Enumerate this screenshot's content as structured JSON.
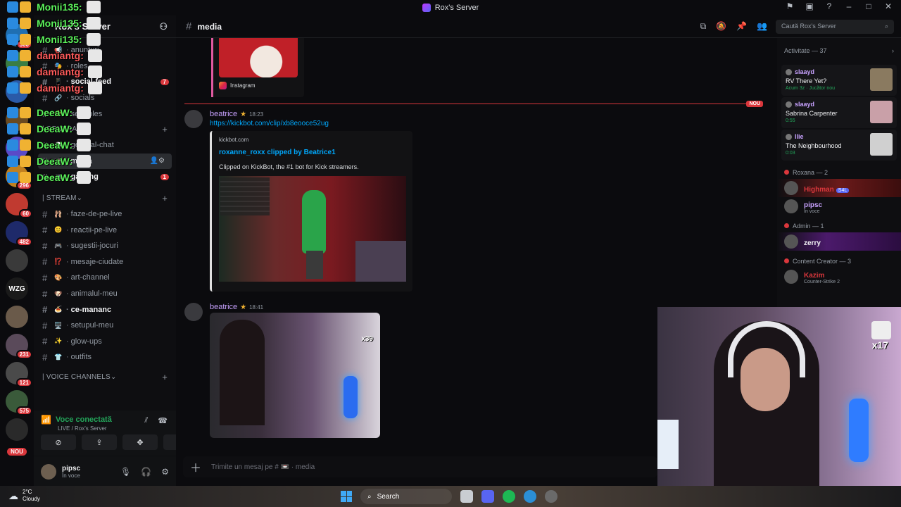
{
  "window": {
    "title": "Rox's Server"
  },
  "server": {
    "name": "Rox's Server"
  },
  "rail": {
    "servers": [
      {
        "label": "",
        "badge": "300",
        "color": "#1f6fb2"
      },
      {
        "label": "",
        "badge": "",
        "color": "#3a7d44"
      },
      {
        "label": "",
        "badge": "",
        "color": "#2a5aa8"
      },
      {
        "label": "",
        "badge": "",
        "color": "#6a4a20"
      },
      {
        "label": "",
        "badge": "",
        "color": "#5a4ac8"
      },
      {
        "label": "",
        "badge": "296",
        "color": "#c08020"
      },
      {
        "label": "",
        "badge": "60",
        "color": "#c03a30"
      },
      {
        "label": "",
        "badge": "482",
        "color": "#1e2a6a"
      },
      {
        "label": "",
        "badge": "",
        "color": "#3a3a3a"
      },
      {
        "label": "WZG",
        "badge": "",
        "color": "#1a1a1a"
      },
      {
        "label": "",
        "badge": "",
        "color": "#6a5a4a"
      },
      {
        "label": "",
        "badge": "231",
        "color": "#5a4a5a"
      },
      {
        "label": "",
        "badge": "121",
        "color": "#4a4a4a"
      },
      {
        "label": "",
        "badge": "575",
        "color": "#3a5a3a"
      },
      {
        "label": "",
        "badge": "",
        "color": "#2a2a2a"
      }
    ],
    "nou_label": "NOU"
  },
  "overlay": {
    "lines": [
      {
        "name": "Monii135:",
        "red": false
      },
      {
        "name": "Monii135:",
        "red": false
      },
      {
        "name": "Monii135:",
        "red": false
      },
      {
        "name": "damiantg:",
        "red": true
      },
      {
        "name": "damiantg:",
        "red": true
      },
      {
        "name": "damiantg:",
        "red": true
      },
      {
        "name": "DeeaW:",
        "red": false
      },
      {
        "name": "DeeaW:",
        "red": false
      },
      {
        "name": "DeeaW:",
        "red": false
      },
      {
        "name": "DeeaW:",
        "red": false
      },
      {
        "name": "DeeaW:",
        "red": false
      }
    ]
  },
  "channels": {
    "top": [
      {
        "name": "anunturi",
        "emoji": "📢",
        "count": ""
      },
      {
        "name": "roles",
        "emoji": "🎭",
        "count": ""
      },
      {
        "name": "social-feed",
        "emoji": "📱",
        "count": "7"
      },
      {
        "name": "socials",
        "emoji": "🔗",
        "count": ""
      },
      {
        "name": "self-roles",
        "emoji": "⭐",
        "count": ""
      }
    ],
    "general_category": "| GENERAL",
    "general": [
      {
        "name": "general-chat",
        "emoji": "💬",
        "count": ""
      },
      {
        "name": "media",
        "emoji": "📼",
        "count": ""
      },
      {
        "name": "gaming",
        "emoji": "🎮",
        "count": "1"
      }
    ],
    "stream_category": "| STREAM",
    "stream": [
      {
        "name": "faze-de-pe-live",
        "emoji": "🩰",
        "bold": false
      },
      {
        "name": "reactii-pe-live",
        "emoji": "😊",
        "bold": false
      },
      {
        "name": "sugestii-jocuri",
        "emoji": "🎮",
        "bold": false
      },
      {
        "name": "mesaje-ciudate",
        "emoji": "⁉️",
        "bold": false
      },
      {
        "name": "art-channel",
        "emoji": "🎨",
        "bold": false
      },
      {
        "name": "animalul-meu",
        "emoji": "🐶",
        "bold": false
      },
      {
        "name": "ce-mananc",
        "emoji": "🍝",
        "bold": true
      },
      {
        "name": "setupul-meu",
        "emoji": "🖥️",
        "bold": false
      },
      {
        "name": "glow-ups",
        "emoji": "✨",
        "bold": false
      },
      {
        "name": "outfits",
        "emoji": "👕",
        "bold": false
      }
    ],
    "voice_category": "| VOICE CHANNELS"
  },
  "voice": {
    "title": "Voce conectată",
    "subtitle": "LIVE / Rox's Server"
  },
  "user": {
    "name": "pipsc",
    "status": "În voce"
  },
  "chat": {
    "channel_name": "media",
    "search_placeholder": "Caută Rox's Server",
    "composer_placeholder": "Trimite un mesaj pe # 📼 · media",
    "new_label": "NOU",
    "instagram_label": "Instagram",
    "messages": [
      {
        "author": "beatrice",
        "time": "18:23",
        "link": "https://kickbot.com/clip/xb8eooce52ug",
        "embed_provider": "kickbot.com",
        "embed_title": "roxanne_roxx clipped by Beatrice1",
        "embed_desc": "Clipped on KickBot, the #1 bot for Kick streamers."
      },
      {
        "author": "beatrice",
        "time": "18:41",
        "image_counter": "x39"
      }
    ]
  },
  "members": {
    "activity_header": "Activitate — 37",
    "activities": [
      {
        "name": "slaayd",
        "title": "RV There Yet?",
        "sub": "Acum 3z  ·  Jucător nou",
        "thumb": "#8a7a60"
      },
      {
        "name": "slaayd",
        "title": "Sabrina Carpenter",
        "sub": "0:55",
        "thumb": "#c9a0a8"
      },
      {
        "name": "llie",
        "title": "The Neighbourhood",
        "sub": "0:03",
        "thumb": "#d0d0d0"
      }
    ],
    "roles": [
      {
        "role": "Roxana — 2",
        "members": [
          {
            "name": "Highman",
            "sub": "",
            "tag": "S4L",
            "color": "#da373c"
          },
          {
            "name": "pipsc",
            "sub": "În voce",
            "tag": "",
            "color": "#c8a2ff"
          }
        ]
      },
      {
        "role": "Admin — 1",
        "members": [
          {
            "name": "zerry",
            "sub": "",
            "tag": "",
            "color": "#f2f3f5"
          }
        ]
      },
      {
        "role": "Content Creator — 3",
        "members": [
          {
            "name": "Kazim",
            "sub": "Counter-Strike 2",
            "tag": "",
            "color": "#da373c"
          }
        ]
      }
    ]
  },
  "webcam": {
    "emote_count": "x17"
  },
  "taskbar": {
    "temp": "2°C",
    "condition": "Cloudy",
    "search_label": "Search"
  }
}
